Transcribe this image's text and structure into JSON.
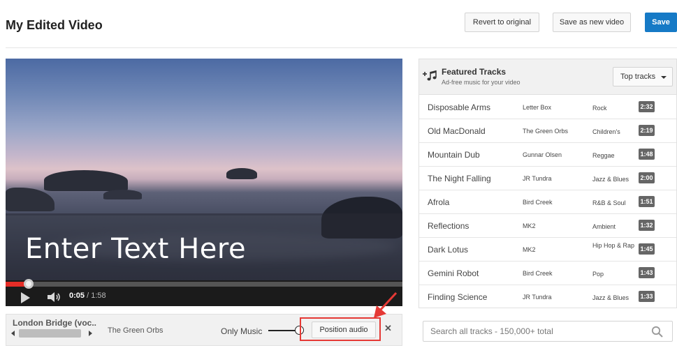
{
  "header": {
    "title": "My Edited Video",
    "revert_label": "Revert to original",
    "save_new_label": "Save as new video",
    "save_label": "Save"
  },
  "player": {
    "overlay_text": "Enter Text Here",
    "current_time": "0:05",
    "separator": "/",
    "duration": "1:58",
    "progress_fraction": 0.058
  },
  "audio": {
    "title": "London Bridge (voc..",
    "artist": "The Green Orbs",
    "mix_label": "Only Music",
    "position_label": "Position audio",
    "close_glyph": "✕"
  },
  "tracks": {
    "title": "Featured Tracks",
    "subtitle": "Ad-free music for your video",
    "sort_label": "Top tracks",
    "items": [
      {
        "name": "Disposable Arms",
        "artist": "Letter Box",
        "genre": "Rock",
        "duration": "2:32"
      },
      {
        "name": "Old MacDonald",
        "artist": "The Green Orbs",
        "genre": "Children's",
        "duration": "2:19"
      },
      {
        "name": "Mountain Dub",
        "artist": "Gunnar Olsen",
        "genre": "Reggae",
        "duration": "1:48"
      },
      {
        "name": "The Night Falling",
        "artist": "JR Tundra",
        "genre": "Jazz & Blues",
        "duration": "2:00"
      },
      {
        "name": "Afrola",
        "artist": "Bird Creek",
        "genre": "R&B & Soul",
        "duration": "1:51"
      },
      {
        "name": "Reflections",
        "artist": "MK2",
        "genre": "Ambient",
        "duration": "1:32"
      },
      {
        "name": "Dark Lotus",
        "artist": "MK2",
        "genre": "Hip Hop & Rap",
        "duration": "1:45"
      },
      {
        "name": "Gemini Robot",
        "artist": "Bird Creek",
        "genre": "Pop",
        "duration": "1:43"
      },
      {
        "name": "Finding Science",
        "artist": "JR Tundra",
        "genre": "Jazz & Blues",
        "duration": "1:33"
      }
    ]
  },
  "search": {
    "placeholder": "Search all tracks - 150,000+ total"
  },
  "colors": {
    "save_blue": "#167ac6",
    "progress_red": "#e52d27",
    "highlight_red": "#e53935"
  },
  "icons": {
    "add_music": "music-add-icon",
    "search": "search-icon",
    "play": "play-icon",
    "volume": "volume-icon",
    "close": "close-icon"
  }
}
